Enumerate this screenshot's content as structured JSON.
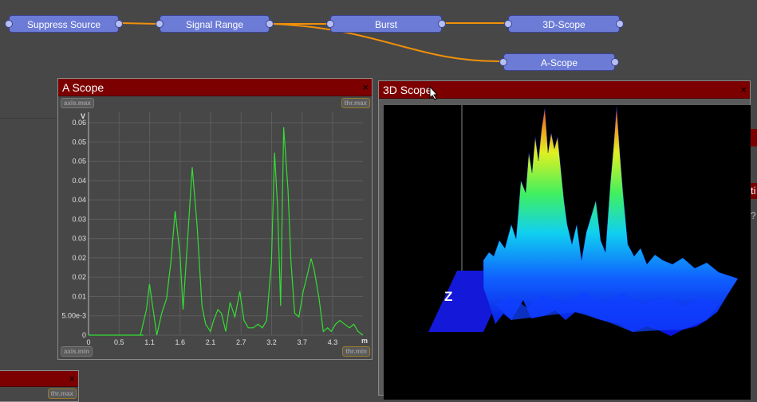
{
  "nodes": {
    "suppress": "Suppress Source",
    "range": "Signal Range",
    "burst": "Burst",
    "scope3d": "3D-Scope",
    "ascope": "A-Scope"
  },
  "ascope_window": {
    "title": "A Scope",
    "close": "×",
    "tags": {
      "axis_max": "axis.max",
      "thr_max": "thr.max",
      "axis_min": "axis.min",
      "thr_min": "thr.min"
    }
  },
  "scope3d_window": {
    "title": "3D Scope",
    "close": "×",
    "z_label": "Z"
  },
  "lower_panel": {
    "close": "×",
    "tag": "thr.max"
  },
  "right_edge_fragments": {
    "a": "ti",
    "b": "?("
  },
  "colors": {
    "window_title": "#7d0000",
    "node": "#6c7cd6",
    "wire": "#f0900a",
    "trace": "#33dd33"
  },
  "chart_data": {
    "type": "line",
    "xlabel": "m",
    "ylabel": "V",
    "xlim": [
      0,
      4.5
    ],
    "ylim": [
      0,
      0.06
    ],
    "x_ticks": [
      "0",
      "0.5",
      "1.1",
      "1.6",
      "2.1",
      "2.7",
      "3.2",
      "3.7",
      "4.3"
    ],
    "y_ticks": [
      "0",
      "5.00e-3",
      "0.01",
      "0.02",
      "0.02",
      "0.03",
      "0.03",
      "0.04",
      "0.04",
      "0.05",
      "0.05",
      "0.06"
    ],
    "series": [
      {
        "x": [
          0,
          0.3,
          0.6,
          0.9,
          0.85,
          0.95,
          1.0,
          1.05,
          1.12,
          1.2,
          1.28,
          1.35,
          1.42,
          1.5,
          1.55,
          1.62,
          1.7,
          1.78,
          1.86,
          1.92,
          2.0,
          2.05,
          2.12,
          2.18,
          2.25,
          2.32,
          2.4,
          2.48,
          2.55,
          2.62,
          2.7,
          2.78,
          2.85,
          2.92,
          3.0,
          3.05,
          3.1,
          3.15,
          3.2,
          3.27,
          3.32,
          3.38,
          3.45,
          3.52,
          3.58,
          3.65,
          3.7,
          3.78,
          3.85,
          3.92,
          3.98,
          4.05,
          4.12,
          4.2,
          4.28,
          4.35,
          4.42,
          4.5
        ],
        "y": [
          0,
          0,
          0,
          0,
          0,
          0.007,
          0.014,
          0.008,
          0,
          0.006,
          0.01,
          0.02,
          0.034,
          0.022,
          0.007,
          0.025,
          0.046,
          0.03,
          0.008,
          0.003,
          0.001,
          0.004,
          0.007,
          0.006,
          0.001,
          0.009,
          0.005,
          0.012,
          0.004,
          0.002,
          0.002,
          0.003,
          0.002,
          0.004,
          0.02,
          0.05,
          0.035,
          0.008,
          0.057,
          0.04,
          0.02,
          0.006,
          0.005,
          0.012,
          0.016,
          0.021,
          0.018,
          0.01,
          0.001,
          0.002,
          0.001,
          0.003,
          0.004,
          0.003,
          0.002,
          0.003,
          0.001,
          0
        ]
      }
    ]
  }
}
